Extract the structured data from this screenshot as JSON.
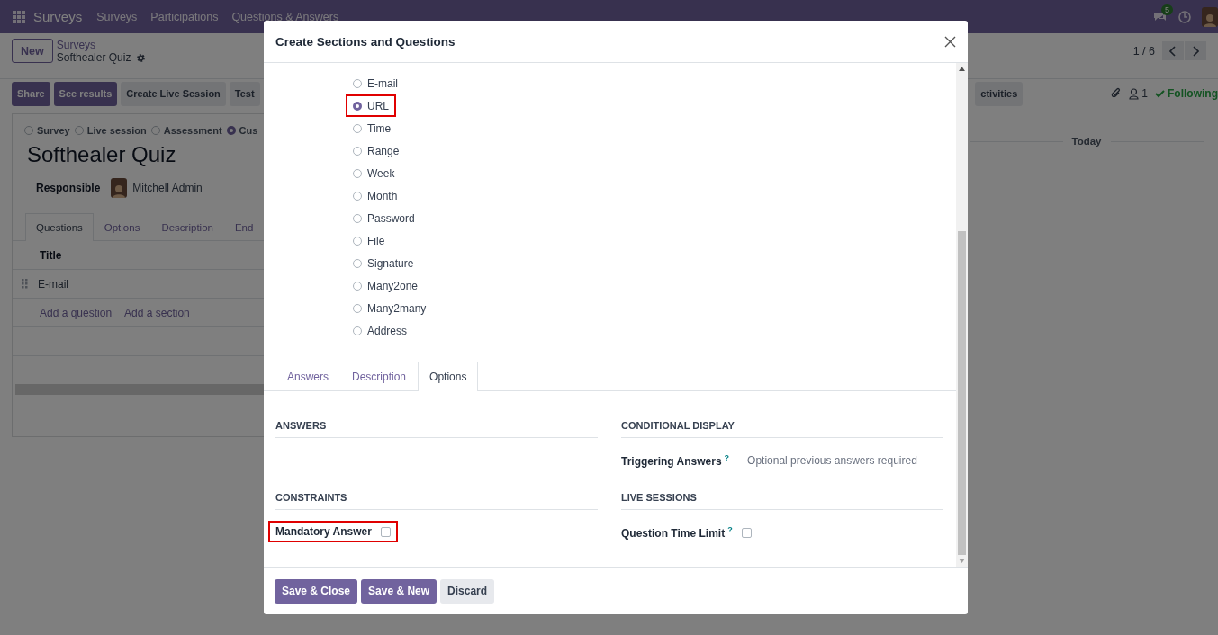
{
  "navbar": {
    "app_name": "Surveys",
    "menu": [
      "Surveys",
      "Participations",
      "Questions & Answers"
    ],
    "chat_badge": "5"
  },
  "control_panel": {
    "new_button": "New",
    "breadcrumb": [
      "Surveys",
      "Softhealer Quiz"
    ],
    "pager": "1 / 6"
  },
  "action_buttons": [
    {
      "label": "Share",
      "kind": "primary"
    },
    {
      "label": "See results",
      "kind": "primary"
    },
    {
      "label": "Create Live Session",
      "kind": "secondary"
    },
    {
      "label": "Test",
      "kind": "secondary"
    }
  ],
  "chatter": {
    "activities_button": "ctivities",
    "followers_count": "1",
    "following": "Following",
    "date_separator": "Today"
  },
  "form": {
    "survey_types": [
      {
        "label": "Survey",
        "selected": false
      },
      {
        "label": "Live session",
        "selected": false
      },
      {
        "label": "Assessment",
        "selected": false
      },
      {
        "label": "Cus",
        "selected": true
      }
    ],
    "title": "Softhealer Quiz",
    "responsible_label": "Responsible",
    "responsible": "Mitchell Admin",
    "tabs": [
      {
        "label": "Questions",
        "selected": true
      },
      {
        "label": "Options",
        "selected": false
      },
      {
        "label": "Description",
        "selected": false
      },
      {
        "label": "End",
        "selected": false
      }
    ],
    "table": {
      "columns": [
        "Title"
      ],
      "rows": [
        "E-mail"
      ],
      "add_links": [
        "Add a question",
        "Add a section"
      ]
    }
  },
  "dialog": {
    "title": "Create Sections and Questions",
    "question_types": [
      {
        "label": "E-mail",
        "selected": false,
        "highlighted": false
      },
      {
        "label": "URL",
        "selected": true,
        "highlighted": true
      },
      {
        "label": "Time",
        "selected": false,
        "highlighted": false
      },
      {
        "label": "Range",
        "selected": false,
        "highlighted": false
      },
      {
        "label": "Week",
        "selected": false,
        "highlighted": false
      },
      {
        "label": "Month",
        "selected": false,
        "highlighted": false
      },
      {
        "label": "Password",
        "selected": false,
        "highlighted": false
      },
      {
        "label": "File",
        "selected": false,
        "highlighted": false
      },
      {
        "label": "Signature",
        "selected": false,
        "highlighted": false
      },
      {
        "label": "Many2one",
        "selected": false,
        "highlighted": false
      },
      {
        "label": "Many2many",
        "selected": false,
        "highlighted": false
      },
      {
        "label": "Address",
        "selected": false,
        "highlighted": false
      }
    ],
    "tabs": [
      {
        "label": "Answers",
        "selected": false
      },
      {
        "label": "Description",
        "selected": false
      },
      {
        "label": "Options",
        "selected": true
      }
    ],
    "option_groups": [
      {
        "title": "ANSWERS"
      },
      {
        "title": "CONDITIONAL DISPLAY",
        "fields": [
          {
            "label": "Triggering Answers",
            "help": "?",
            "kind": "tags",
            "placeholder": "Optional previous answers required",
            "highlighted": false
          }
        ]
      },
      {
        "title": "CONSTRAINTS",
        "fields": [
          {
            "label": "Mandatory Answer",
            "kind": "checkbox",
            "checked": false,
            "highlighted": true
          }
        ]
      },
      {
        "title": "LIVE SESSIONS",
        "fields": [
          {
            "label": "Question Time Limit",
            "help": "?",
            "kind": "checkbox",
            "checked": false,
            "highlighted": false
          }
        ]
      }
    ],
    "buttons": [
      {
        "label": "Save & Close",
        "kind": "primary"
      },
      {
        "label": "Save & New",
        "kind": "primary"
      },
      {
        "label": "Discard",
        "kind": "secondary"
      }
    ]
  }
}
